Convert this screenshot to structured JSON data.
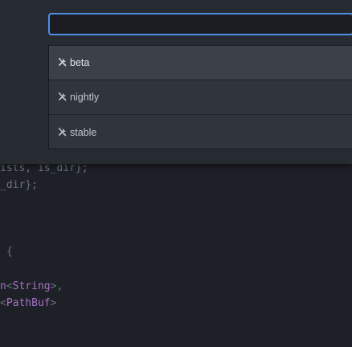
{
  "palette": {
    "input_value": "",
    "items": [
      {
        "label": "beta",
        "icon": "tools-icon",
        "selected": true
      },
      {
        "label": "nightly",
        "icon": "tools-icon",
        "selected": false
      },
      {
        "label": "stable",
        "icon": "tools-icon",
        "selected": false
      }
    ]
  },
  "editor": {
    "lines": [
      {
        "parts": [
          {
            "text": "ists, is_dir};",
            "cls": "pn"
          }
        ]
      },
      {
        "parts": [
          {
            "text": "_dir};",
            "cls": "pn"
          }
        ]
      },
      {
        "parts": [
          {
            "text": " {",
            "cls": "pn"
          }
        ]
      },
      {
        "parts": [
          {
            "text": "n",
            "cls": "kw"
          },
          {
            "text": "<",
            "cls": "pn"
          },
          {
            "text": "String",
            "cls": "ty"
          },
          {
            "text": ">,",
            "cls": "pn"
          }
        ]
      },
      {
        "parts": [
          {
            "text": "<",
            "cls": "pn"
          },
          {
            "text": "PathBuf",
            "cls": "ty"
          },
          {
            "text": ">",
            "cls": "pn"
          }
        ]
      }
    ]
  },
  "colors": {
    "background": "#1d2026",
    "palette_bg": "#262a31",
    "input_focus_border": "#4e8fe6",
    "selected_item_bg": "#3b4049",
    "keyword": "#a871c4"
  }
}
